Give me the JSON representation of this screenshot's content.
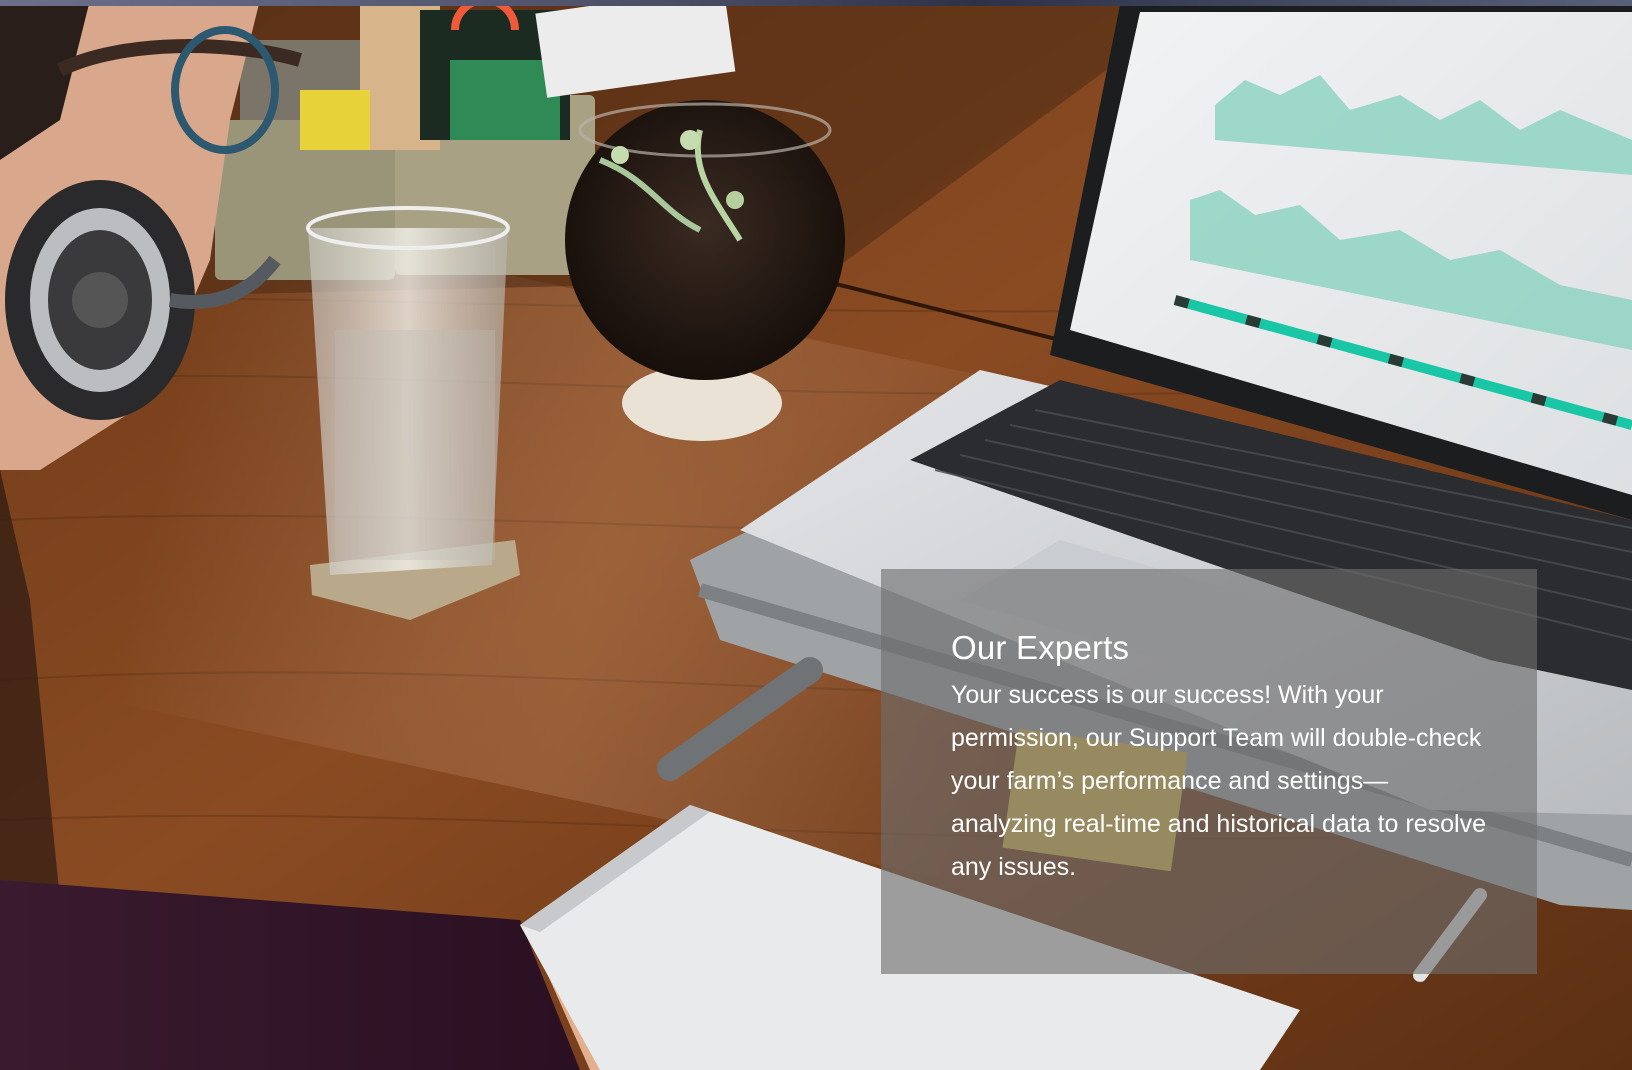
{
  "section": {
    "title": "Our Experts",
    "body": "Your success is our success! With your permission, our Support Team will double-check your farm’s performance and settings—analyzing real-time and historical data to resolve any issues."
  },
  "colors": {
    "card_overlay": "#6e6e6e",
    "chart_teal": "#8fd3c2",
    "bar_teal": "#19c6a5",
    "desk": "#7a4321",
    "text": "#ffffff"
  },
  "icons": {
    "hero": "photo-of-support-agent-at-desk-with-laptop"
  }
}
